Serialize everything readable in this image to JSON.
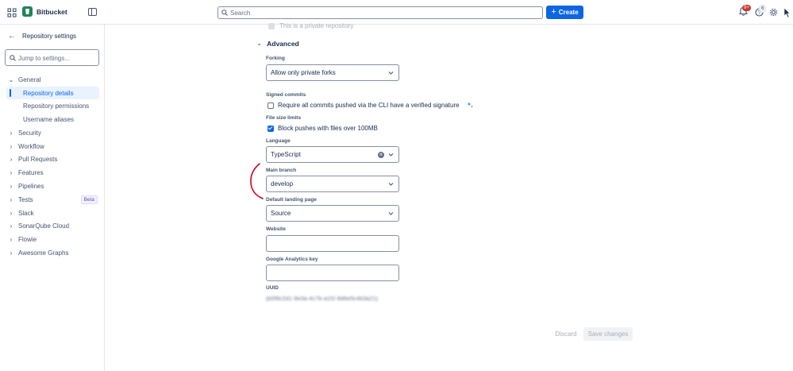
{
  "app": {
    "name": "Bitbucket"
  },
  "topbar": {
    "search_placeholder": "Search",
    "create_label": "Create",
    "notifications_badge": "9+",
    "help_badge": "6"
  },
  "sidebar": {
    "back_label": "Repository settings",
    "jump_placeholder": "Jump to settings...",
    "items": [
      {
        "label": "General",
        "expanded": true
      },
      {
        "label": "Repository details",
        "active": true
      },
      {
        "label": "Repository permissions"
      },
      {
        "label": "Username aliases"
      },
      {
        "label": "Security"
      },
      {
        "label": "Workflow"
      },
      {
        "label": "Pull Requests"
      },
      {
        "label": "Features"
      },
      {
        "label": "Pipelines"
      },
      {
        "label": "Tests",
        "badge": "Beta"
      },
      {
        "label": "Slack"
      },
      {
        "label": "SonarQube Cloud"
      },
      {
        "label": "Flowie"
      },
      {
        "label": "Awesome Graphs"
      }
    ]
  },
  "form": {
    "private_label": "This is a private repository",
    "advanced_heading": "Advanced",
    "forking": {
      "label": "Forking",
      "value": "Allow only private forks"
    },
    "signed_commits": {
      "label": "Signed commits",
      "option": "Require all commits pushed via the CLI have a verified signature",
      "checked": false
    },
    "file_size": {
      "label": "File size limits",
      "option": "Block pushes with files over 100MB",
      "checked": true
    },
    "language": {
      "label": "Language",
      "value": "TypeScript"
    },
    "main_branch": {
      "label": "Main branch",
      "value": "develop"
    },
    "landing_page": {
      "label": "Default landing page",
      "value": "Source"
    },
    "website": {
      "label": "Website",
      "value": ""
    },
    "analytics": {
      "label": "Google Analytics key",
      "value": ""
    },
    "uuid": {
      "label": "UUID",
      "value": "{b0f8c2d1-9e3a-4c7b-a1f2-8d6e5c4b3a21}"
    }
  },
  "actions": {
    "discard_label": "Discard",
    "save_label": "Save changes"
  },
  "colors": {
    "primary": "#0c66e4",
    "brand": "#1f845a",
    "annotation": "#d0021b"
  }
}
